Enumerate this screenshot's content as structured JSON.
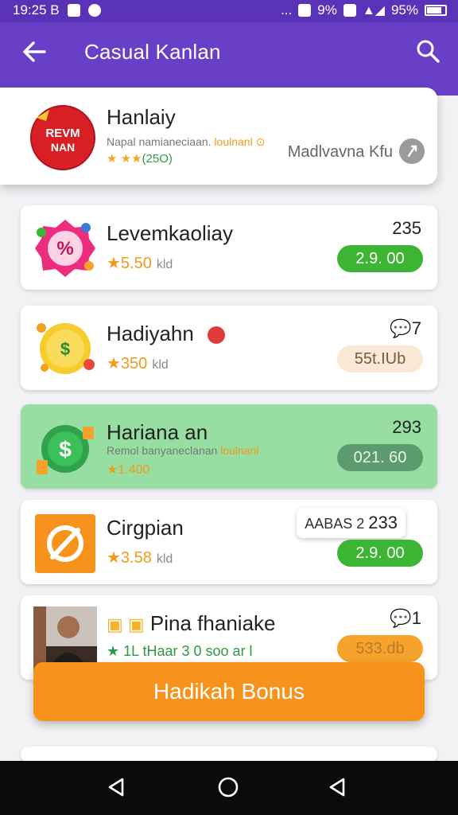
{
  "statusbar": {
    "time": "19:25 B",
    "signal": "9%",
    "battery": "95%",
    "dots": "..."
  },
  "appbar": {
    "title": "Casual Kanlan"
  },
  "featured": {
    "name": "Hanlaiy",
    "subtitle": "Napal namianeciaan.",
    "subtitle_accent": "loulnanl",
    "rating": "(25O)",
    "developer": "Madlvavna Kfu",
    "badge_text": "REVM NAN"
  },
  "list": [
    {
      "name": "Levemkaoliay",
      "rating": "★5.50",
      "sub": "kld",
      "count": "235",
      "price": "2.9. 00",
      "style": "green"
    },
    {
      "name": "Hadiyahn",
      "rating": "★350",
      "sub": "kld",
      "count": "7",
      "price": "55t.IUb",
      "style": "beige"
    },
    {
      "name": "Hariana an",
      "subtitle": "Remol banyaneclanan",
      "subtitle_accent": "loulnanl",
      "rating": "★1.400",
      "count": "293",
      "price": "021. 60",
      "style": "gray"
    },
    {
      "name": "Cirgpian",
      "rating": "★3.58",
      "sub": "kld",
      "count": "233",
      "price": "2.9. 00",
      "style": "green",
      "tooltip": "AABAS 2"
    },
    {
      "name": "Pina fhaniake",
      "rating": "★ 1L tHaar 3 0 soo ar l",
      "count": "1",
      "price": "533.db",
      "style": "orange"
    }
  ],
  "bonus_button": "Hadikah Bonus",
  "colors": {
    "primary": "#6a3fc8",
    "green": "#3cb534",
    "orange": "#f7931d"
  }
}
